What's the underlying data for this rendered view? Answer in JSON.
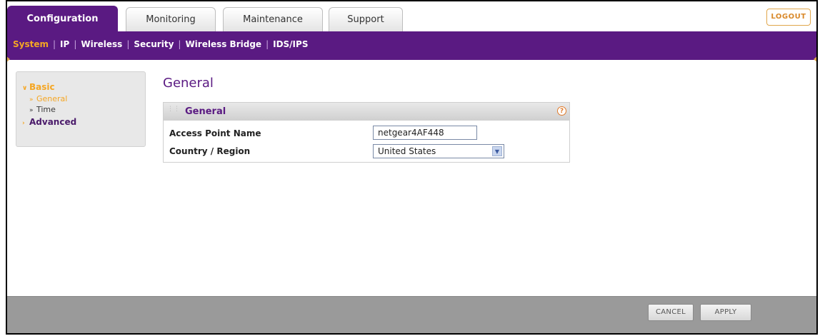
{
  "tabs": [
    {
      "label": "Configuration",
      "active": true
    },
    {
      "label": "Monitoring",
      "active": false
    },
    {
      "label": "Maintenance",
      "active": false
    },
    {
      "label": "Support",
      "active": false
    }
  ],
  "logout_label": "LOGOUT",
  "subnav": {
    "items": [
      "System",
      "IP",
      "Wireless",
      "Security",
      "Wireless Bridge",
      "IDS/IPS"
    ],
    "active": "System"
  },
  "sidebar": {
    "basic": "Basic",
    "general": "General",
    "time": "Time",
    "advanced": "Advanced"
  },
  "page_title": "General",
  "panel": {
    "title": "General",
    "help_icon": "?",
    "fields": {
      "ap_name_label": "Access Point Name",
      "ap_name_value": "netgear4AF448",
      "country_label": "Country / Region",
      "country_value": "United States"
    }
  },
  "footer": {
    "cancel_label": "CANCEL",
    "apply_label": "APPLY"
  },
  "colors": {
    "brand_purple": "#5a1a82",
    "accent_orange": "#f5a623"
  }
}
